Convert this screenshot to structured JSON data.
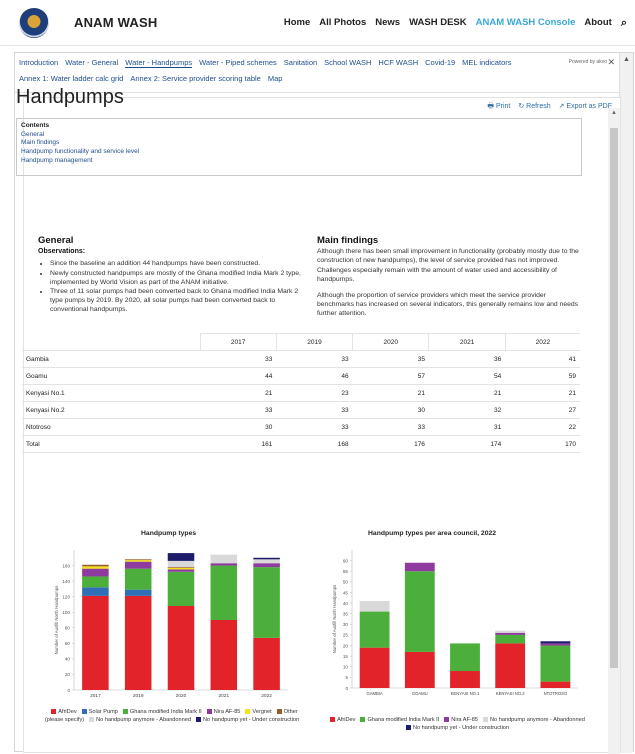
{
  "header": {
    "brand": "ANAM WASH",
    "nav": [
      "Home",
      "All Photos",
      "News",
      "WASH DESK",
      "ANAM WASH Console",
      "About"
    ],
    "active_nav": "ANAM WASH Console",
    "search_icon": "search-icon"
  },
  "tabs": {
    "row1": [
      "Introduction",
      "Water - General",
      "Water - Handpumps",
      "Water - Piped schemes",
      "Sanitation",
      "School WASH",
      "HCF WASH",
      "Covid-19",
      "MEL indicators"
    ],
    "row2": [
      "Annex 1: Water ladder calc grid",
      "Annex 2: Service provider scoring table",
      "Map"
    ],
    "active": "Water - Handpumps",
    "powered": "Powered by akvo"
  },
  "actions": {
    "print": "Print",
    "refresh": "Refresh",
    "export": "Export as PDF"
  },
  "page": {
    "title": "Handpumps",
    "toc_title": "Contents",
    "toc": [
      "General",
      "Main findings",
      "Handpump functionality and service level",
      "Handpump management"
    ]
  },
  "general": {
    "heading": "General",
    "subheading": "Observations:",
    "bullets": [
      "Since the baseline an addition 44 handpumps have been constructed.",
      "Newly constructed handpumps are mostly of the Ghana modified India Mark 2 type, implemented by World Vision as part of the ANAM initiative.",
      "Three of 11 solar pumps had been converted back to Ghana modified India Mark 2 type pumps by 2019. By 2020, all solar pumps had been converted back to conventional handpumps."
    ]
  },
  "findings": {
    "heading": "Main findings",
    "paragraphs": [
      "Although there has been small improvement in functionality (probably mostly due to the construction of new handpumps), the level of service provided has not improved. Challenges especially remain with the amount of water used and accessibility of handpumps.",
      "Although the proportion of service providers which meet the service provider benchmarks has increased on several indicators, this generally remains low and needs further attention."
    ]
  },
  "table": {
    "headers": [
      "",
      "2017",
      "2019",
      "2020",
      "2021",
      "2022"
    ],
    "rows": [
      [
        "Gambia",
        "33",
        "33",
        "35",
        "36",
        "41"
      ],
      [
        "Goamu",
        "44",
        "46",
        "57",
        "54",
        "59"
      ],
      [
        "Kenyasi No.1",
        "21",
        "23",
        "21",
        "21",
        "21"
      ],
      [
        "Kenyasi No.2",
        "33",
        "33",
        "30",
        "32",
        "27"
      ],
      [
        "Ntotroso",
        "30",
        "33",
        "33",
        "31",
        "22"
      ],
      [
        "Total",
        "161",
        "168",
        "176",
        "174",
        "170"
      ]
    ]
  },
  "colors": {
    "AfriDev": "#e3232a",
    "Solar Pump": "#2f6fb7",
    "Ghana modified India Mark II": "#4caf3c",
    "Nira AF-85": "#8e3a9e",
    "Vergnet": "#f2e21a",
    "Other (please specify)": "#9a5a2a",
    "No handpump anymore - Abandonned": "#d9d9d9",
    "No handpump yet - Under construction": "#1c1c6b",
    "link": "#1f4e8c",
    "accent": "#3aa7d8"
  },
  "chart_data": [
    {
      "type": "bar",
      "stacked": true,
      "title": "Handpump types",
      "ylabel": "Number of Ausfill North Handpumps",
      "ylim": [
        0,
        180
      ],
      "yticks": [
        0,
        20,
        40,
        60,
        80,
        100,
        120,
        140,
        160
      ],
      "categories": [
        "2017",
        "2019",
        "2020",
        "2021",
        "2022"
      ],
      "series": [
        {
          "name": "AfriDev",
          "values": [
            121,
            121,
            108,
            90,
            67
          ]
        },
        {
          "name": "Solar Pump",
          "values": [
            11,
            8,
            0,
            0,
            0
          ]
        },
        {
          "name": "Ghana modified India Mark II",
          "values": [
            14,
            27,
            44,
            70,
            91
          ]
        },
        {
          "name": "Nira AF-85",
          "values": [
            10,
            9,
            3,
            3,
            5
          ]
        },
        {
          "name": "Vergnet",
          "values": [
            3,
            2,
            2,
            0,
            0
          ]
        },
        {
          "name": "Other (please specify)",
          "values": [
            2,
            1,
            1,
            0,
            0
          ]
        },
        {
          "name": "No handpump anymore - Abandonned",
          "values": [
            0,
            0,
            8,
            11,
            5
          ]
        },
        {
          "name": "No handpump yet - Under construction",
          "values": [
            0,
            0,
            10,
            0,
            2
          ]
        }
      ],
      "legend_position": "bottom"
    },
    {
      "type": "bar",
      "stacked": true,
      "title": "Handpump types per area council, 2022",
      "ylabel": "Number of Ausfill North Handpumps",
      "ylim": [
        0,
        65
      ],
      "yticks": [
        0,
        5,
        10,
        15,
        20,
        25,
        30,
        35,
        40,
        45,
        50,
        55,
        60
      ],
      "categories": [
        "GAMBIA",
        "GOAMU",
        "KENYASI NO.1",
        "KENYASI NO.2",
        "NTOTROSO"
      ],
      "series": [
        {
          "name": "AfriDev",
          "values": [
            19,
            17,
            8,
            21,
            3
          ]
        },
        {
          "name": "Ghana modified India Mark II",
          "values": [
            17,
            38,
            13,
            4,
            17
          ]
        },
        {
          "name": "Nira AF-85",
          "values": [
            0,
            4,
            0,
            1,
            1
          ]
        },
        {
          "name": "No handpump anymore - Abandonned",
          "values": [
            5,
            0,
            0,
            1,
            0
          ]
        },
        {
          "name": "No handpump yet - Under construction",
          "values": [
            0,
            0,
            0,
            0,
            1
          ]
        }
      ],
      "legend_position": "bottom"
    }
  ]
}
